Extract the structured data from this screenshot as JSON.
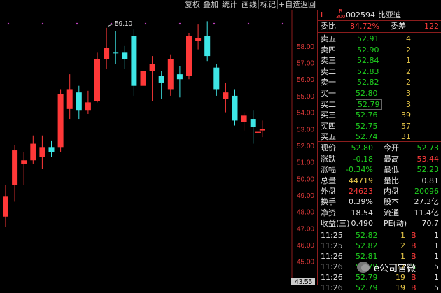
{
  "toolbar": {
    "buttons": [
      "复权",
      "叠加",
      "统计",
      "画线",
      "标记",
      "+自选",
      "返回"
    ]
  },
  "chart": {
    "peak_label": "59.10",
    "current_marker": "52.79",
    "axis_labels": [
      "58.00",
      "57.00",
      "56.00",
      "55.00",
      "54.00",
      "53.00",
      "52.00",
      "51.00",
      "50.00",
      "49.00",
      "48.00",
      "47.00",
      "46.00",
      "45.00"
    ],
    "bottom_label": "43.55"
  },
  "chart_data": {
    "type": "candlestick",
    "ylim": [
      43.55,
      59.6
    ],
    "candles": [
      {
        "o": 47.7,
        "c": 48.9,
        "h": 49.6,
        "l": 47.1,
        "dir": "up"
      },
      {
        "o": 49.6,
        "c": 51.7,
        "h": 52.0,
        "l": 48.6,
        "dir": "up"
      },
      {
        "o": 50.9,
        "c": 51.1,
        "h": 51.6,
        "l": 49.6,
        "dir": "up"
      },
      {
        "o": 51.1,
        "c": 52.1,
        "h": 52.6,
        "l": 50.9,
        "dir": "up"
      },
      {
        "o": 51.3,
        "c": 51.9,
        "h": 52.6,
        "l": 50.6,
        "dir": "up"
      },
      {
        "o": 51.9,
        "c": 51.6,
        "h": 52.3,
        "l": 51.3,
        "dir": "down"
      },
      {
        "o": 51.9,
        "c": 55.1,
        "h": 55.4,
        "l": 51.6,
        "dir": "up"
      },
      {
        "o": 54.2,
        "c": 55.4,
        "h": 56.3,
        "l": 53.6,
        "dir": "up"
      },
      {
        "o": 55.2,
        "c": 54.1,
        "h": 55.6,
        "l": 53.6,
        "dir": "down"
      },
      {
        "o": 54.1,
        "c": 54.6,
        "h": 55.3,
        "l": 53.9,
        "dir": "up"
      },
      {
        "o": 54.7,
        "c": 57.2,
        "h": 57.6,
        "l": 54.6,
        "dir": "up"
      },
      {
        "o": 57.2,
        "c": 57.9,
        "h": 59.1,
        "l": 56.6,
        "dir": "up"
      },
      {
        "o": 57.6,
        "c": 57.6,
        "h": 58.9,
        "l": 56.9,
        "dir": "down"
      },
      {
        "o": 57.6,
        "c": 57.2,
        "h": 58.0,
        "l": 56.6,
        "dir": "down"
      },
      {
        "o": 58.6,
        "c": 55.6,
        "h": 59.0,
        "l": 55.0,
        "dir": "down"
      },
      {
        "o": 55.6,
        "c": 56.5,
        "h": 56.7,
        "l": 55.0,
        "dir": "up"
      },
      {
        "o": 56.5,
        "c": 56.9,
        "h": 57.4,
        "l": 54.7,
        "dir": "up"
      },
      {
        "o": 56.2,
        "c": 55.8,
        "h": 56.5,
        "l": 54.8,
        "dir": "down"
      },
      {
        "o": 55.4,
        "c": 57.2,
        "h": 57.5,
        "l": 55.0,
        "dir": "up"
      },
      {
        "o": 56.3,
        "c": 56.0,
        "h": 56.8,
        "l": 54.9,
        "dir": "down"
      },
      {
        "o": 56.2,
        "c": 58.6,
        "h": 58.8,
        "l": 56.0,
        "dir": "up"
      },
      {
        "o": 58.3,
        "c": 58.5,
        "h": 59.3,
        "l": 57.8,
        "dir": "up"
      },
      {
        "o": 58.6,
        "c": 57.4,
        "h": 59.5,
        "l": 57.1,
        "dir": "down"
      },
      {
        "o": 56.7,
        "c": 55.4,
        "h": 56.9,
        "l": 55.0,
        "dir": "down"
      },
      {
        "o": 54.8,
        "c": 55.2,
        "h": 55.8,
        "l": 54.0,
        "dir": "up"
      },
      {
        "o": 55.0,
        "c": 53.5,
        "h": 55.4,
        "l": 53.2,
        "dir": "down"
      },
      {
        "o": 53.4,
        "c": 53.8,
        "h": 54.0,
        "l": 52.9,
        "dir": "up"
      },
      {
        "o": 53.6,
        "c": 53.1,
        "h": 54.1,
        "l": 52.1,
        "dir": "down"
      },
      {
        "o": 53.0,
        "c": 52.9,
        "h": 53.5,
        "l": 52.5,
        "dir": "up"
      }
    ]
  },
  "panel": {
    "code_prefix": "L",
    "badge_top": "R",
    "badge_bottom": "300",
    "stock_code": "002594",
    "stock_name": "比亚迪",
    "webi_label": "委比",
    "webi_value": "84.72%",
    "weicha_label": "委差",
    "weicha_value": "122",
    "sells": [
      {
        "label": "卖五",
        "price": "52.91",
        "vol": "4"
      },
      {
        "label": "卖四",
        "price": "52.90",
        "vol": "2"
      },
      {
        "label": "卖三",
        "price": "52.84",
        "vol": "1"
      },
      {
        "label": "卖二",
        "price": "52.83",
        "vol": "2"
      },
      {
        "label": "卖一",
        "price": "52.82",
        "vol": "2"
      }
    ],
    "buys": [
      {
        "label": "买一",
        "price": "52.80",
        "vol": "3"
      },
      {
        "label": "买二",
        "price": "52.79",
        "vol": "3"
      },
      {
        "label": "买三",
        "price": "52.76",
        "vol": "39"
      },
      {
        "label": "买四",
        "price": "52.75",
        "vol": "57"
      },
      {
        "label": "买五",
        "price": "52.74",
        "vol": "31"
      }
    ],
    "stats": [
      {
        "l1": "现价",
        "v1": "52.80",
        "c1": "green",
        "l2": "今开",
        "v2": "52.73",
        "c2": "green"
      },
      {
        "l1": "涨跌",
        "v1": "-0.18",
        "c1": "green",
        "l2": "最高",
        "v2": "53.44",
        "c2": "red"
      },
      {
        "l1": "涨幅",
        "v1": "-0.34%",
        "c1": "green",
        "l2": "最低",
        "v2": "52.23",
        "c2": "green"
      },
      {
        "l1": "总量",
        "v1": "44719",
        "c1": "yellow",
        "l2": "量比",
        "v2": "0.81",
        "c2": "white"
      },
      {
        "l1": "外盘",
        "v1": "24623",
        "c1": "red",
        "l2": "内盘",
        "v2": "20096",
        "c2": "green"
      }
    ],
    "stats2": [
      {
        "l1": "换手",
        "v1": "0.39%",
        "l2": "股本",
        "v2": "27.3亿"
      },
      {
        "l1": "净资",
        "v1": "18.54",
        "l2": "流通",
        "v2": "11.4亿"
      },
      {
        "l1": "收益(三)",
        "v1": "0.490",
        "l2": "PE(动)",
        "v2": "70.7"
      }
    ],
    "ticks": [
      {
        "t": "11:25",
        "p": "52.82",
        "v": "1",
        "d": "B",
        "n": "1",
        "pc": "green",
        "dc": "red"
      },
      {
        "t": "11:25",
        "p": "52.82",
        "v": "2",
        "d": "B",
        "n": "1",
        "pc": "green",
        "dc": "red"
      },
      {
        "t": "11:26",
        "p": "52.81",
        "v": "1",
        "d": "B",
        "n": "1",
        "pc": "green",
        "dc": "red"
      },
      {
        "t": "11:26",
        "p": "52.79",
        "v": "17",
        "d": "S",
        "n": "5",
        "pc": "green",
        "dc": "green"
      },
      {
        "t": "11:26",
        "p": "52.79",
        "v": "19",
        "d": "B",
        "n": "1",
        "pc": "green",
        "dc": "red"
      },
      {
        "t": "11:26",
        "p": "52.79",
        "v": "19",
        "d": "B",
        "n": "5",
        "pc": "green",
        "dc": "red"
      }
    ]
  },
  "watermark": "e公司官微"
}
